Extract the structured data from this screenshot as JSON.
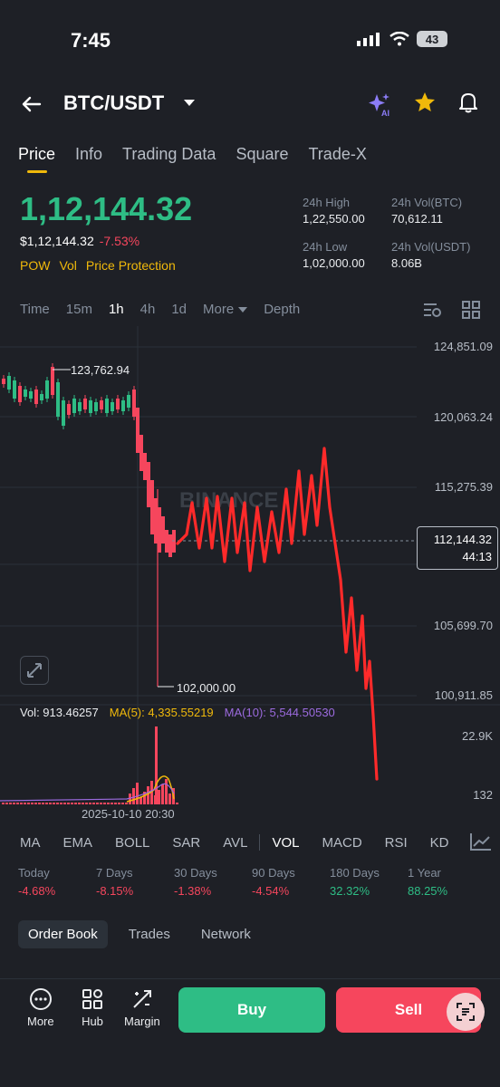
{
  "status_bar": {
    "time": "7:45",
    "battery": "43"
  },
  "header": {
    "pair": "BTC/USDT"
  },
  "tabs": [
    "Price",
    "Info",
    "Trading Data",
    "Square",
    "Trade-X"
  ],
  "ticker": {
    "last_price": "1,12,144.32",
    "fiat_price": "$1,12,144.32",
    "change_pct": "-7.53%",
    "tags": [
      "POW",
      "Vol",
      "Price Protection"
    ],
    "high_label": "24h High",
    "high": "1,22,550.00",
    "vol_btc_label": "24h Vol(BTC)",
    "vol_btc": "70,612.11",
    "low_label": "24h Low",
    "low": "1,02,000.00",
    "vol_usdt_label": "24h Vol(USDT)",
    "vol_usdt": "8.06B"
  },
  "intervals": {
    "time": "Time",
    "m15": "15m",
    "h1": "1h",
    "h4": "4h",
    "d1": "1d",
    "more": "More",
    "depth": "Depth"
  },
  "chart": {
    "y_labels": [
      "124,851.09",
      "120,063.24",
      "115,275.39",
      "105,699.70",
      "100,911.85"
    ],
    "current_price": "112,144.32",
    "countdown": "44:13",
    "high_marker": "123,762.94",
    "low_marker": "102,000.00",
    "watermark": "BINANCE",
    "vol_label": "Vol: 913.46257",
    "ma5_label": "MA(5): 4,335.55219",
    "ma10_label": "MA(10): 5,544.50530",
    "vol_y_labels": [
      "22.9K",
      "132"
    ],
    "date_label": "2025-10-10 20:30",
    "colors": {
      "up": "#2ebd85",
      "down": "#f6465d",
      "drawing": "#ff2a2a",
      "ma5": "#f0b90b",
      "ma10": "#9c6bdf"
    }
  },
  "indicators": [
    "MA",
    "EMA",
    "BOLL",
    "SAR",
    "AVL",
    "VOL",
    "MACD",
    "RSI",
    "KD"
  ],
  "performance": [
    {
      "label": "Today",
      "value": "-4.68%"
    },
    {
      "label": "7 Days",
      "value": "-8.15%"
    },
    {
      "label": "30 Days",
      "value": "-1.38%"
    },
    {
      "label": "90 Days",
      "value": "-4.54%"
    },
    {
      "label": "180 Days",
      "value": "32.32%"
    },
    {
      "label": "1 Year",
      "value": "88.25%"
    }
  ],
  "sub_tabs": [
    "Order Book",
    "Trades",
    "Network"
  ],
  "bottom_nav": {
    "more": "More",
    "hub": "Hub",
    "margin": "Margin",
    "buy": "Buy",
    "sell": "Sell"
  }
}
